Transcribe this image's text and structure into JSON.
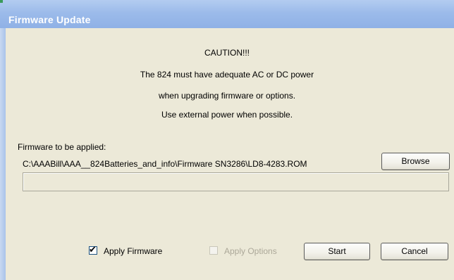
{
  "window": {
    "title": "Firmware Update"
  },
  "caution": {
    "heading": "CAUTION!!!",
    "line1": "The 824 must have adequate AC or DC power",
    "line2": "when upgrading firmware or options.",
    "line3": "Use external power when possible."
  },
  "firmware": {
    "label": "Firmware to be applied:",
    "path": "C:\\AAABill\\AAA__824Batteries_and_info\\Firmware SN3286\\LD8-4283.ROM"
  },
  "buttons": {
    "browse": "Browse",
    "start": "Start",
    "cancel": "Cancel"
  },
  "progress": {
    "fraction": 0
  },
  "options": {
    "apply_firmware": {
      "label": "Apply Firmware",
      "checked": true,
      "enabled": true,
      "check_glyph": "✔"
    },
    "apply_options": {
      "label": "Apply Options",
      "checked": false,
      "enabled": false
    }
  }
}
